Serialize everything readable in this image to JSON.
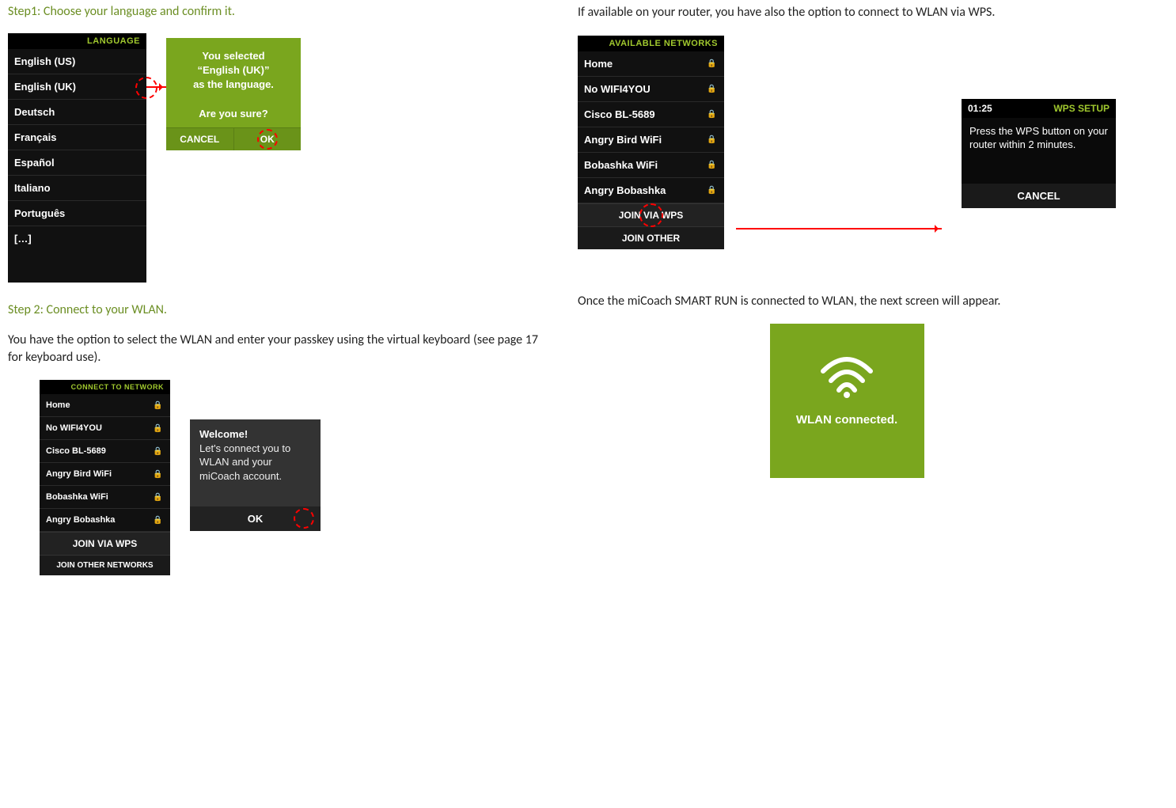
{
  "left": {
    "step1_heading": "Step1: Choose your language and confirm it.",
    "lang_menu": {
      "header": "LANGUAGE",
      "items": [
        "English (US)",
        "English (UK)",
        "Deutsch",
        "Français",
        "Español",
        "Italiano",
        "Português",
        "[…]"
      ]
    },
    "lang_confirm": {
      "message": "You selected\n“English (UK)”\nas the language.\n\nAre you sure?",
      "cancel": "CANCEL",
      "ok": "OK"
    },
    "step2_heading": "Step 2: Connect to your WLAN.",
    "step2_body": "You have the option to select the WLAN and enter your passkey using the virtual keyboard (see page 17 for keyboard use).",
    "net_menu": {
      "header": "CONNECT TO NETWORK",
      "items": [
        {
          "name": "Home",
          "lock": true
        },
        {
          "name": "No WIFI4YOU",
          "lock": true
        },
        {
          "name": "Cisco BL-5689",
          "lock": true
        },
        {
          "name": "Angry Bird WiFi",
          "lock": true
        },
        {
          "name": "Bobashka WiFi",
          "lock": true
        },
        {
          "name": "Angry Bobashka",
          "lock": true
        }
      ],
      "btn1": "JOIN VIA WPS",
      "btn2": "JOIN OTHER NETWORKS"
    },
    "welcome_dialog": {
      "title": "Welcome!",
      "body": "Let's connect you to WLAN and your miCoach account.",
      "ok": "OK"
    }
  },
  "right": {
    "wps_intro": "If available on your router, you have also the option to connect to WLAN via WPS.",
    "avail_menu": {
      "header": "AVAILABLE  NETWORKS",
      "items": [
        {
          "name": "Home",
          "lock": true
        },
        {
          "name": "No WIFI4YOU",
          "lock": true
        },
        {
          "name": "Cisco BL-5689",
          "lock": true
        },
        {
          "name": "Angry Bird WiFi",
          "lock": true
        },
        {
          "name": "Bobashka WiFi",
          "lock": true
        },
        {
          "name": "Angry Bobashka",
          "lock": true
        }
      ],
      "btn1": "JOIN VIA WPS",
      "btn2": "JOIN OTHER"
    },
    "wps_dialog": {
      "time": "01:25",
      "title": "WPS SETUP",
      "message": "Press the WPS button on your router within 2 minutes.",
      "cancel": "CANCEL"
    },
    "connected_intro": "Once the miCoach SMART RUN is connected to WLAN, the next screen will appear.",
    "connected_label": "WLAN connected."
  }
}
